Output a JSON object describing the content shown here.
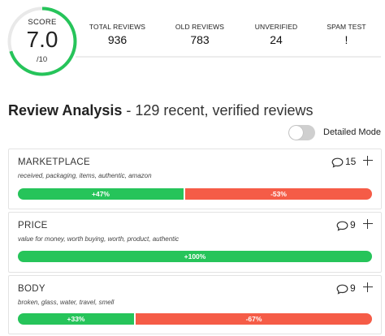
{
  "score": {
    "label": "SCORE",
    "value": "7.0",
    "denominator": "/10",
    "fraction": 0.7,
    "ring_color": "#26c45a"
  },
  "stats": [
    {
      "label": "TOTAL REVIEWS",
      "value": "936"
    },
    {
      "label": "OLD REVIEWS",
      "value": "783"
    },
    {
      "label": "UNVERIFIED",
      "value": "24"
    },
    {
      "label": "SPAM TEST",
      "value": "!"
    }
  ],
  "analysis": {
    "title": "Review Analysis",
    "subtitle": " - 129 recent, verified reviews",
    "toggle_label": "Detailed Mode",
    "toggle_on": false
  },
  "colors": {
    "positive": "#26c45a",
    "negative": "#f55c47"
  },
  "categories": [
    {
      "title": "MARKETPLACE",
      "keywords": "received, packaging, items, authentic, amazon",
      "comment_count": "15",
      "positive_pct": 47,
      "positive_label": "+47%",
      "negative_pct": 53,
      "negative_label": "-53%"
    },
    {
      "title": "PRICE",
      "keywords": "value for money, worth buying, worth, product, authentic",
      "comment_count": "9",
      "positive_pct": 100,
      "positive_label": "+100%",
      "negative_pct": 0,
      "negative_label": ""
    },
    {
      "title": "BODY",
      "keywords": "broken, glass, water, travel, smell",
      "comment_count": "9",
      "positive_pct": 33,
      "positive_label": "+33%",
      "negative_pct": 67,
      "negative_label": "-67%"
    }
  ]
}
